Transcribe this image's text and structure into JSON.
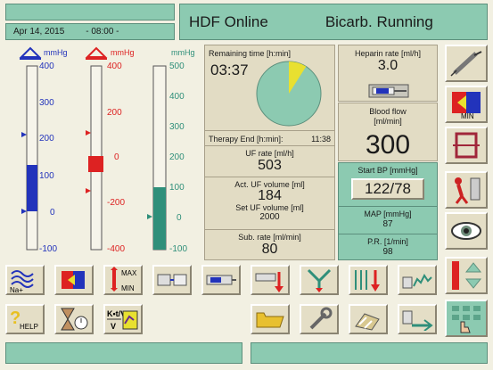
{
  "header": {
    "date": "Apr 14, 2015",
    "time": "- 08:00 -",
    "mode": "HDF Online",
    "status": "Bicarb. Running"
  },
  "pressures": {
    "arterial": {
      "unit": "mmHg",
      "ticks": [
        "400",
        "300",
        "200",
        "100",
        "0",
        "-100"
      ],
      "value": 32,
      "color": "#2233bb"
    },
    "venous": {
      "unit": "mmHg",
      "ticks": [
        "400",
        "200",
        "0",
        "-200",
        "-400"
      ],
      "value": 0,
      "color": "#dd2222"
    },
    "tmp": {
      "unit": "mmHg",
      "ticks": [
        "500",
        "400",
        "300",
        "200",
        "100",
        "0",
        "-100"
      ],
      "value": 100,
      "color": "#2f8f7a"
    }
  },
  "therapy": {
    "remaining_label": "Remaining time [h:min]",
    "remaining_value": "03:37",
    "remaining_fraction": 0.09,
    "end_label": "Therapy End [h:min]:",
    "end_value": "11:38",
    "uf_rate_label": "UF rate  [ml/h]",
    "uf_rate_value": "503",
    "act_uf_label": "Act. UF volume  [ml]",
    "act_uf_value": "184",
    "set_uf_label": "Set UF volume  [ml]",
    "set_uf_value": "2000",
    "sub_rate_label": "Sub. rate [ml/min]",
    "sub_rate_value": "80"
  },
  "right": {
    "heparin_label": "Heparin rate  [ml/h]",
    "heparin_value": "3.0",
    "blood_flow_label": "Blood flow\n[ml/min]",
    "blood_flow_value": "300",
    "start_bp_label": "Start BP [mmHg]",
    "bp_value": "122/78",
    "map_label": "MAP  [mmHg]",
    "map_value": "87",
    "pr_label": "P.R.  [1/min]",
    "pr_value": "98"
  },
  "buttons": {
    "na_label": "Na+",
    "help_label": "HELP",
    "max_label": "MAX",
    "min_label": "MIN",
    "ktv_label": "K•t/V",
    "min_side_label": "MIN"
  },
  "colors": {
    "accent_green": "#8ccab1",
    "panel": "#e2dcc4",
    "yellow": "#e8e030"
  }
}
